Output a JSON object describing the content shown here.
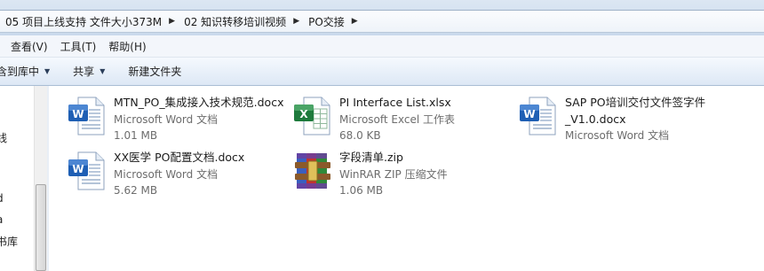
{
  "breadcrumbs": [
    {
      "label": "05 项目上线支持 文件大小373M"
    },
    {
      "label": "02 知识转移培训视频"
    },
    {
      "label": "PO交接"
    }
  ],
  "menu": {
    "items": [
      {
        "label": "查看(V)"
      },
      {
        "label": "工具(T)"
      },
      {
        "label": "帮助(H)"
      }
    ]
  },
  "toolbar": {
    "include_label": "含到库中",
    "share_label": "共享",
    "new_folder_label": "新建文件夹"
  },
  "nav": {
    "fragments": [
      "线",
      "d",
      "a",
      "书库"
    ]
  },
  "files": [
    {
      "name": "MTN_PO_集成接入技术规范.docx",
      "type": "Microsoft Word 文档",
      "size": "1.01 MB",
      "icon": "word-doc-icon"
    },
    {
      "name": "PI Interface List.xlsx",
      "type": "Microsoft Excel 工作表",
      "size": "68.0 KB",
      "icon": "excel-sheet-icon"
    },
    {
      "name": "SAP PO培训交付文件签字件",
      "name2": "_V1.0.docx",
      "type": "Microsoft Word 文档",
      "icon": "word-doc-icon"
    },
    {
      "name": "XX医学 PO配置文档.docx",
      "type": "Microsoft Word 文档",
      "size": "5.62 MB",
      "icon": "word-doc-icon"
    },
    {
      "name": "字段清单.zip",
      "type": "WinRAR ZIP 压缩文件",
      "size": "1.06 MB",
      "icon": "winrar-archive-icon"
    }
  ],
  "colors": {
    "word_blue": "#1f5fb4",
    "excel_green": "#1e7a3c",
    "toolbar_gradient_top": "#f5f9fe",
    "toolbar_gradient_bottom": "#dde8f5"
  }
}
